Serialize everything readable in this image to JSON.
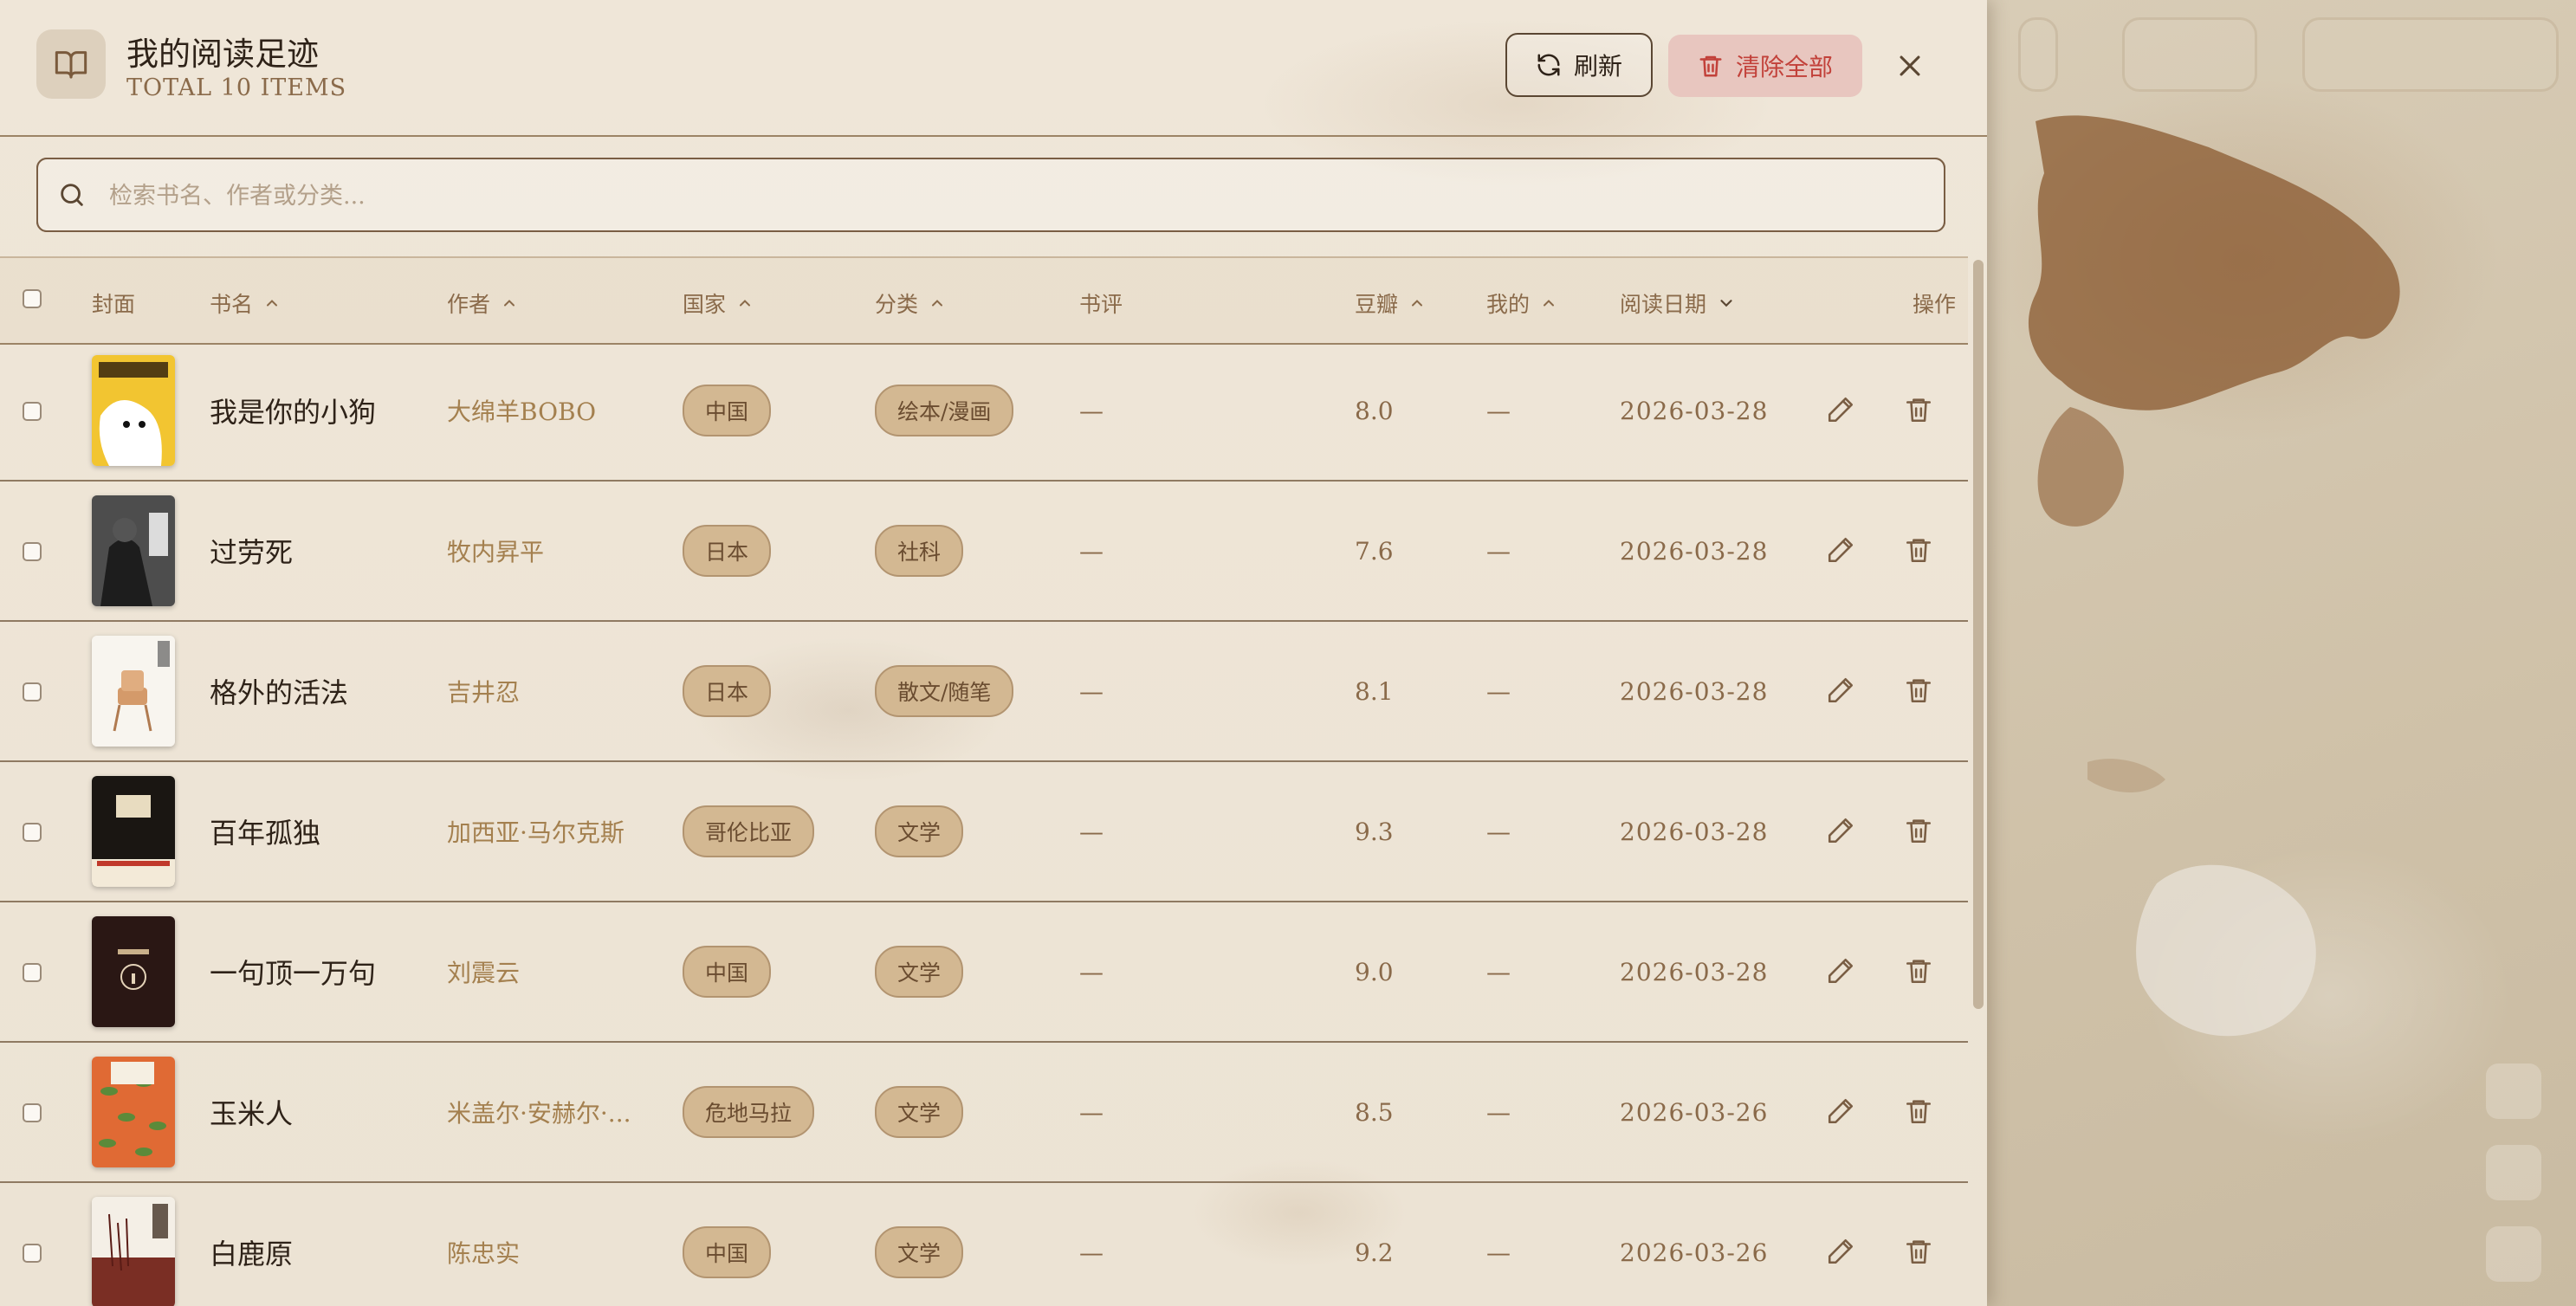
{
  "header": {
    "title": "我的阅读足迹",
    "subtitle": "TOTAL 10 ITEMS",
    "refresh_label": "刷新",
    "clear_label": "清除全部"
  },
  "search": {
    "placeholder": "检索书名、作者或分类..."
  },
  "columns": {
    "cover": "封面",
    "title": "书名",
    "author": "作者",
    "country": "国家",
    "category": "分类",
    "review": "书评",
    "douban": "豆瓣",
    "mine": "我的",
    "date": "阅读日期",
    "actions": "操作"
  },
  "rows": [
    {
      "title": "我是你的小狗",
      "author": "大绵羊BOBO",
      "country": "中国",
      "category": "绘本/漫画",
      "review": "—",
      "douban": "8.0",
      "mine": "—",
      "date": "2026-03-28"
    },
    {
      "title": "过劳死",
      "author": "牧内昇平",
      "country": "日本",
      "category": "社科",
      "review": "—",
      "douban": "7.6",
      "mine": "—",
      "date": "2026-03-28"
    },
    {
      "title": "格外的活法",
      "author": "吉井忍",
      "country": "日本",
      "category": "散文/随笔",
      "review": "—",
      "douban": "8.1",
      "mine": "—",
      "date": "2026-03-28"
    },
    {
      "title": "百年孤独",
      "author": "加西亚·马尔克斯",
      "country": "哥伦比亚",
      "category": "文学",
      "review": "—",
      "douban": "9.3",
      "mine": "—",
      "date": "2026-03-28"
    },
    {
      "title": "一句顶一万句",
      "author": "刘震云",
      "country": "中国",
      "category": "文学",
      "review": "—",
      "douban": "9.0",
      "mine": "—",
      "date": "2026-03-28"
    },
    {
      "title": "玉米人",
      "author": "米盖尔·安赫尔·...",
      "country": "危地马拉",
      "category": "文学",
      "review": "—",
      "douban": "8.5",
      "mine": "—",
      "date": "2026-03-26"
    },
    {
      "title": "白鹿原",
      "author": "陈忠实",
      "country": "中国",
      "category": "文学",
      "review": "—",
      "douban": "9.2",
      "mine": "—",
      "date": "2026-03-26"
    }
  ],
  "colors": {
    "accent_brown": "#8a6a4a",
    "danger": "#c2413a",
    "pill_bg": "#d3b892"
  },
  "icons": {
    "header": "book-open-icon",
    "refresh": "refresh-icon",
    "clear": "trash-icon",
    "close": "close-icon",
    "search": "search-icon",
    "sort": "chevron-up-icon",
    "sort_active": "chevron-down-icon",
    "edit": "pencil-icon",
    "delete": "trash-icon"
  }
}
